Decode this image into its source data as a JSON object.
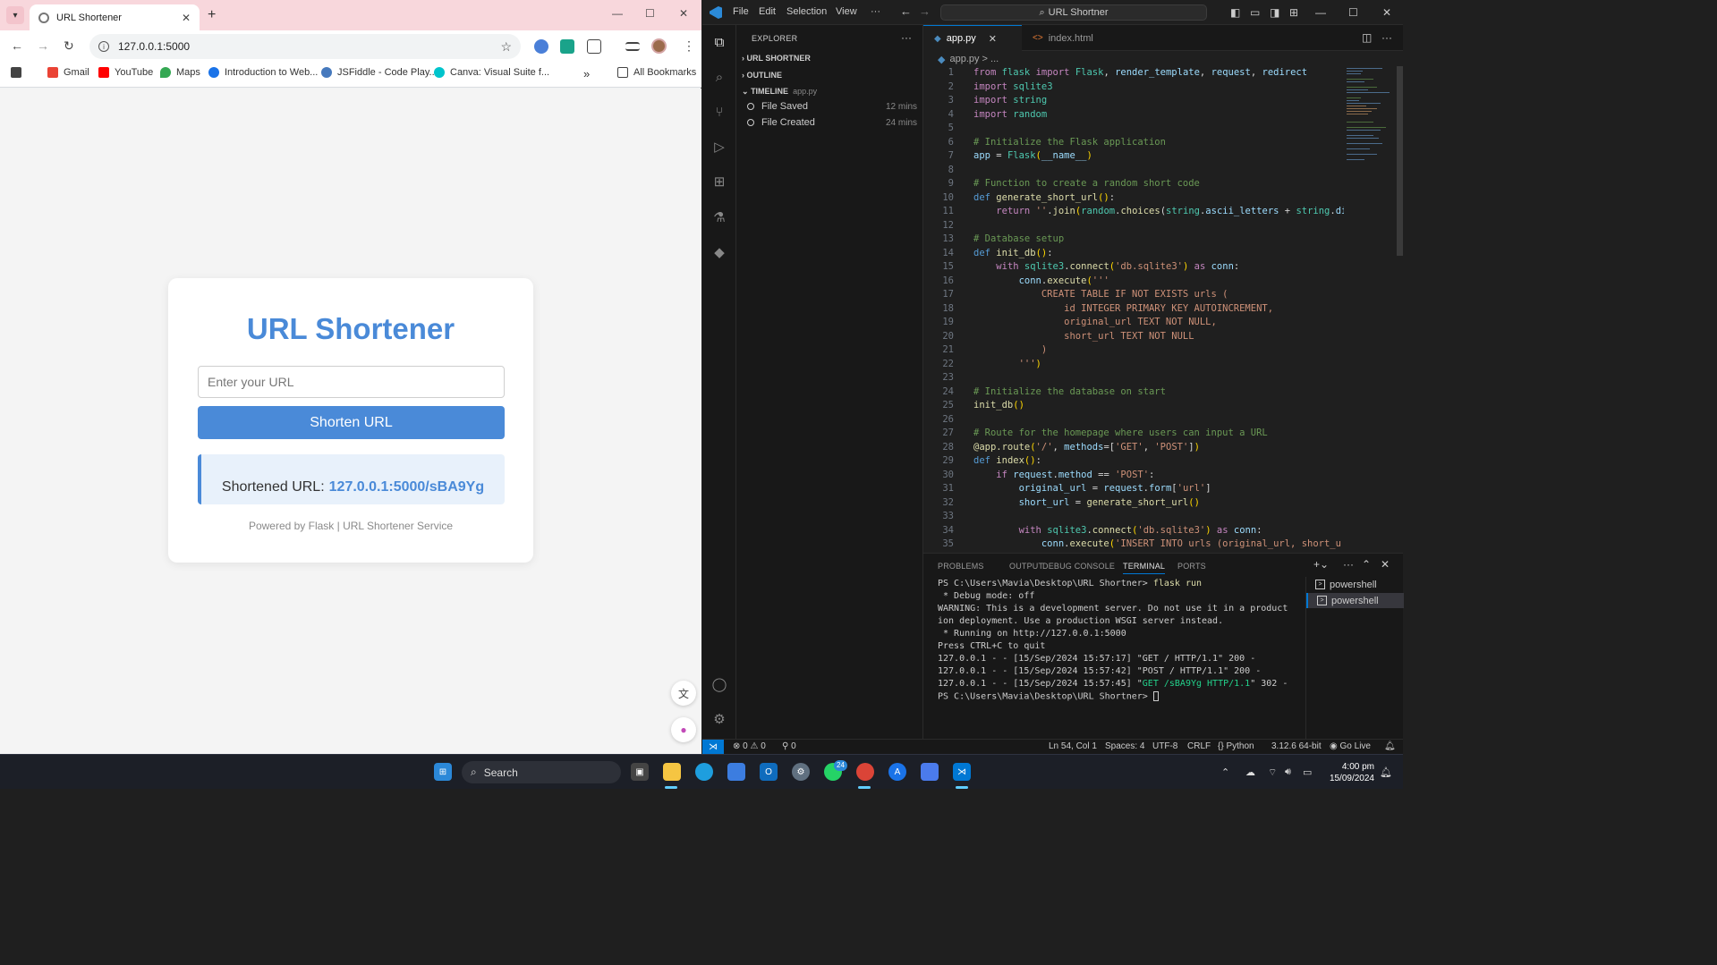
{
  "browser": {
    "tab_title": "URL Shortener",
    "address": "127.0.0.1:5000",
    "bookmarks": [
      {
        "label": "Gmail",
        "color": "#ea4335"
      },
      {
        "label": "YouTube",
        "color": "#ff0000"
      },
      {
        "label": "Maps",
        "color": "#34a853"
      },
      {
        "label": "Introduction to Web...",
        "color": "#1a73e8"
      },
      {
        "label": "JSFiddle - Code Play...",
        "color": "#4679bd"
      },
      {
        "label": "Canva: Visual Suite f...",
        "color": "#00c4cc"
      }
    ],
    "all_bookmarks": "All Bookmarks",
    "page": {
      "heading": "URL Shortener",
      "input_placeholder": "Enter your URL",
      "button": "Shorten URL",
      "result_label": "Shortened URL:",
      "result_link": "127.0.0.1:5000/sBA9Yg",
      "footer": "Powered by Flask | URL Shortener Service"
    }
  },
  "vscode": {
    "menu": [
      "File",
      "Edit",
      "Selection",
      "View",
      "···"
    ],
    "search": "URL Shortner",
    "explorer_title": "EXPLORER",
    "sections": {
      "project": "URL SHORTNER",
      "outline": "OUTLINE",
      "timeline": "TIMELINE",
      "timeline_file": "app.py"
    },
    "timeline_items": [
      {
        "label": "File Saved",
        "time": "12 mins"
      },
      {
        "label": "File Created",
        "time": "24 mins"
      }
    ],
    "tabs": [
      {
        "label": "app.py",
        "active": true
      },
      {
        "label": "index.html",
        "active": false
      }
    ],
    "breadcrumb": "app.py > ...",
    "panel_tabs": [
      "PROBLEMS",
      "OUTPUT",
      "DEBUG CONSOLE",
      "TERMINAL",
      "PORTS"
    ],
    "active_panel_tab": "TERMINAL",
    "terminal_lines": [
      "PS C:\\Users\\Mavia\\Desktop\\URL Shortner> flask run",
      " * Debug mode: off",
      "WARNING: This is a development server. Do not use it in a product",
      "ion deployment. Use a production WSGI server instead.",
      " * Running on http://127.0.0.1:5000",
      "Press CTRL+C to quit",
      "127.0.0.1 - - [15/Sep/2024 15:57:17] \"GET / HTTP/1.1\" 200 -",
      "127.0.0.1 - - [15/Sep/2024 15:57:42] \"POST / HTTP/1.1\" 200 -",
      "127.0.0.1 - - [15/Sep/2024 15:57:45] \"GET /sBA9Yg HTTP/1.1\" 302 -",
      "PS C:\\Users\\Mavia\\Desktop\\URL Shortner> "
    ],
    "terminals": [
      "powershell",
      "powershell"
    ],
    "status": {
      "errors": "0",
      "warnings": "0",
      "ports": "0",
      "position": "Ln 54, Col 1",
      "spaces": "Spaces: 4",
      "encoding": "UTF-8",
      "eol": "CRLF",
      "language": "Python",
      "interpreter": "3.12.6 64-bit",
      "golive": "Go Live"
    }
  },
  "taskbar": {
    "search": "Search",
    "time": "4:00 pm",
    "date": "15/09/2024",
    "whatsapp_badge": "24"
  }
}
